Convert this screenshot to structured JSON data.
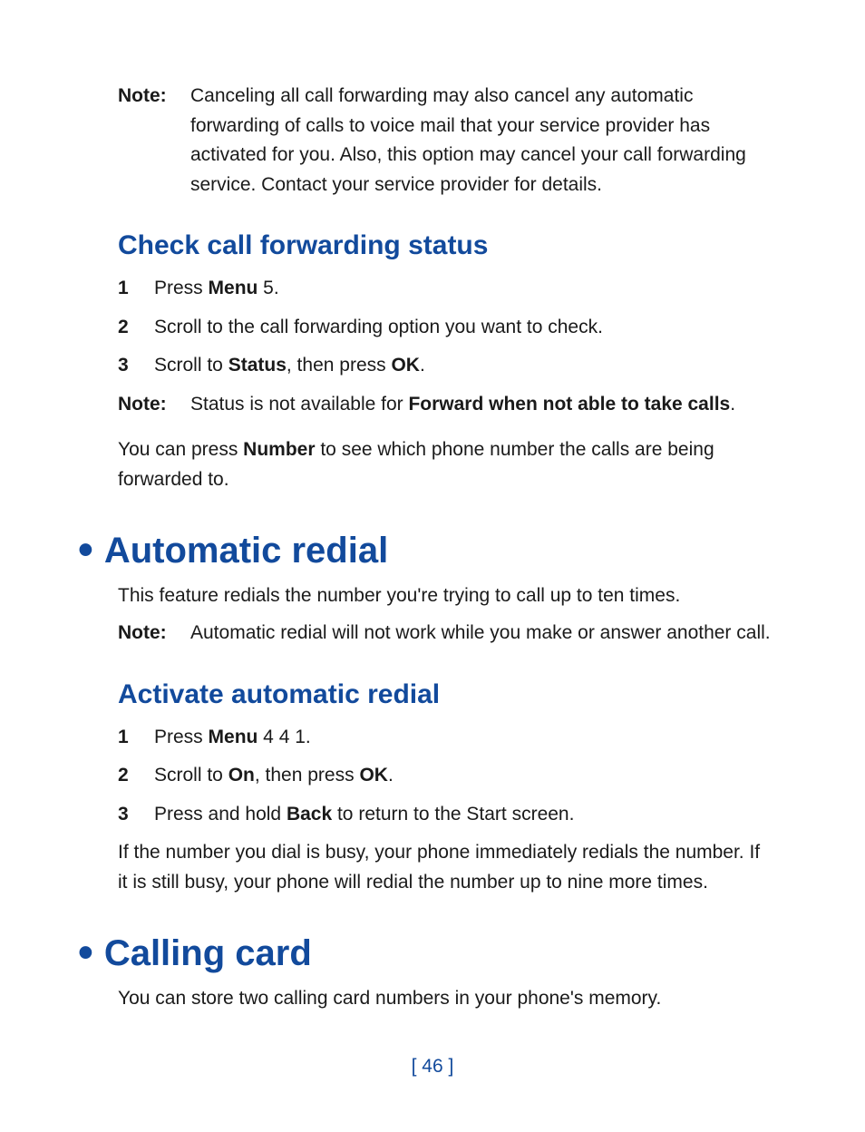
{
  "noteLabel": "Note:",
  "topNote": "Canceling all call forwarding may also cancel any automatic forwarding of calls to voice mail that your service provider has activated for you. Also, this option may cancel your call forwarding service. Contact your service provider for details.",
  "checkStatus": {
    "heading": "Check call forwarding status",
    "steps": [
      {
        "num": "1",
        "pre": "Press ",
        "bold1": "Menu",
        "post1": " 5."
      },
      {
        "num": "2",
        "plain": "Scroll to the call forwarding option you want to check."
      },
      {
        "num": "3",
        "pre": "Scroll to ",
        "bold1": "Status",
        "mid": ", then press ",
        "bold2": "OK",
        "post2": "."
      }
    ],
    "note": {
      "pre": "Status is not available for ",
      "bold": "Forward when not able to take calls",
      "post": "."
    },
    "para": {
      "pre": "You can press ",
      "bold": "Number",
      "post": " to see which phone number the calls are being forwarded to."
    }
  },
  "autoRedial": {
    "heading": "Automatic redial",
    "intro": "This feature redials the number you're trying to call up to ten times.",
    "note": "Automatic redial will not work while you make or answer another call.",
    "subheading": "Activate automatic redial",
    "steps": [
      {
        "num": "1",
        "pre": "Press ",
        "bold1": "Menu",
        "post1": " 4 4 1."
      },
      {
        "num": "2",
        "pre": "Scroll to ",
        "bold1": "On",
        "mid": ", then press ",
        "bold2": "OK",
        "post2": "."
      },
      {
        "num": "3",
        "pre": "Press and hold ",
        "bold1": "Back",
        "post1": " to return to the Start screen."
      }
    ],
    "outro": "If the number you dial is busy, your phone immediately redials the number. If it is still busy, your phone will redial the number up to nine more times."
  },
  "callingCard": {
    "heading": "Calling card",
    "intro": "You can store two calling card numbers in your phone's memory."
  },
  "pageNumber": "[ 46 ]"
}
